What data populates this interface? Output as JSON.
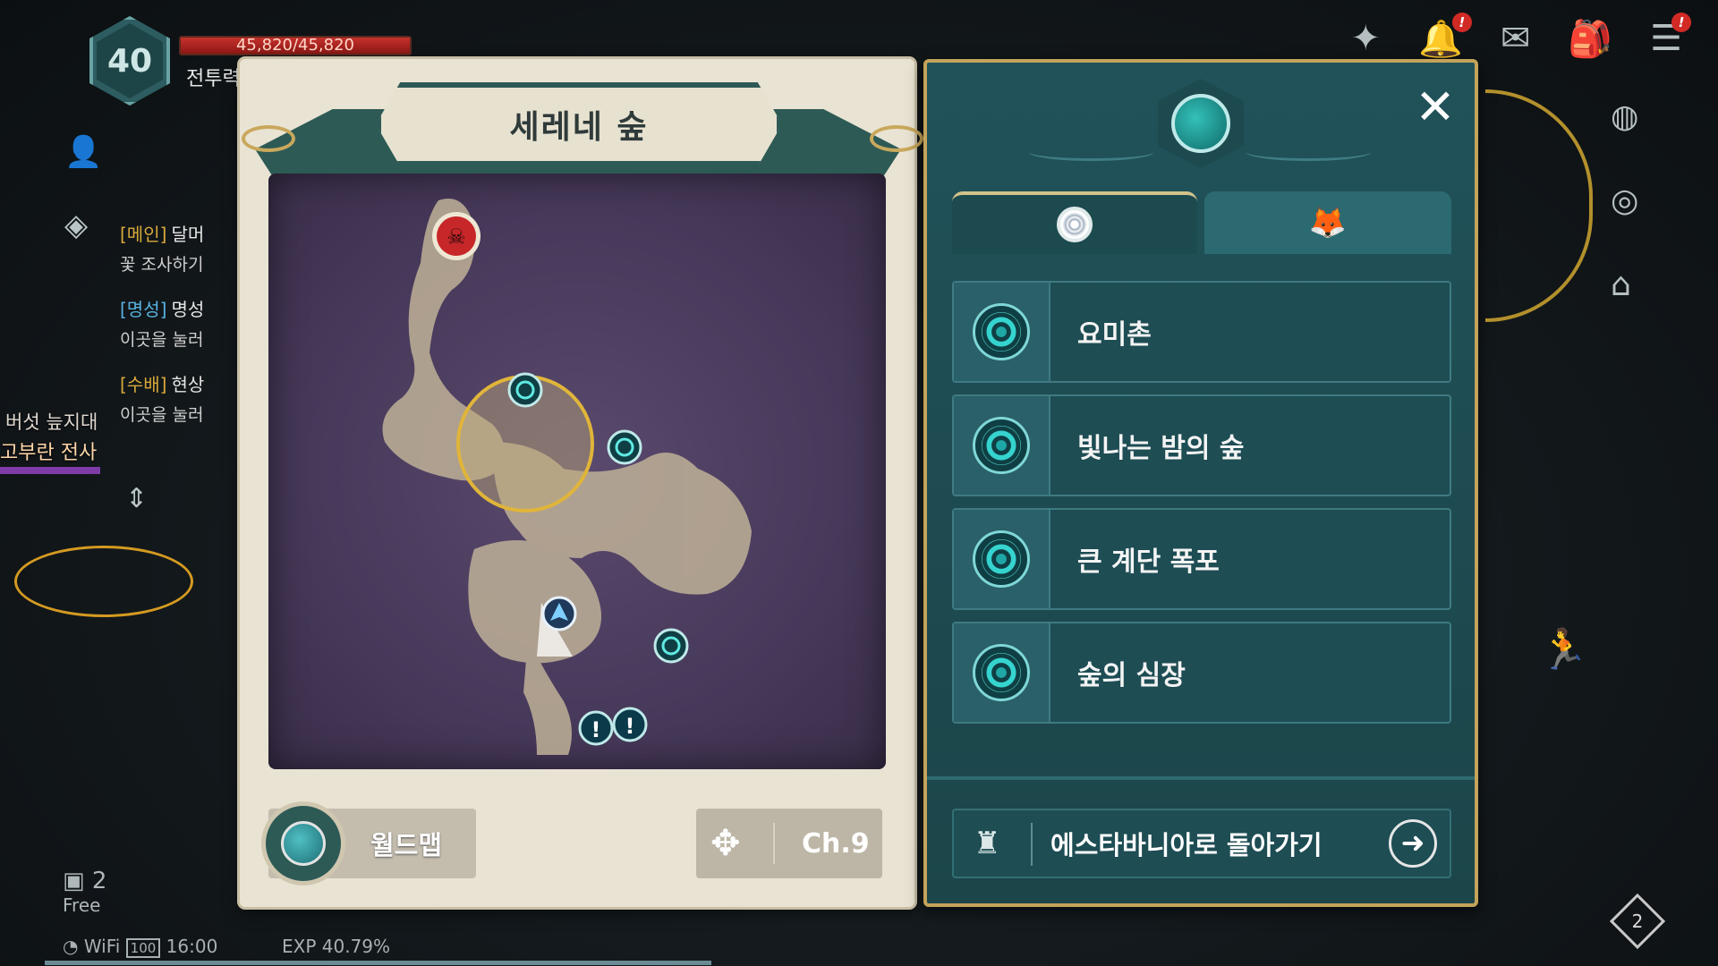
{
  "hud": {
    "level": "40",
    "hp_text": "45,820/45,820",
    "hp_fraction": 1.0,
    "cp_label": "전투력",
    "quests": [
      {
        "tag": "[메인]",
        "name": "달머",
        "sub": "꽃 조사하기",
        "tag_color": "#d8a93b"
      },
      {
        "tag": "[명성]",
        "name": "명성",
        "sub": "이곳을 눌러",
        "tag_color": "#58b3e0"
      },
      {
        "tag": "[수배]",
        "name": "현상",
        "sub": "이곳을 눌러",
        "tag_color": "#d8a93b"
      }
    ],
    "area_name": "버섯 늪지대",
    "enemy_name": "고부란 전사",
    "free_label": "Free",
    "free_count": "2",
    "wifi_label": "WiFi",
    "battery": "100",
    "clock": "16:00",
    "exp": "EXP 40.79%",
    "page_badge": "2"
  },
  "map": {
    "title": "세레네 숲",
    "world_map_label": "월드맵",
    "channel_label": "Ch.9",
    "markers": [
      {
        "type": "boss",
        "icon": "demon-skull-icon"
      },
      {
        "type": "waypoint",
        "icon": "spiral-icon"
      },
      {
        "type": "waypoint",
        "icon": "spiral-icon"
      },
      {
        "type": "waypoint",
        "icon": "spiral-icon"
      },
      {
        "type": "player",
        "icon": "player-arrow-icon"
      },
      {
        "type": "quest",
        "icon": "exclamation-icon"
      },
      {
        "type": "quest",
        "icon": "exclamation-icon"
      }
    ]
  },
  "teleport": {
    "close_symbol": "✕",
    "tabs": [
      {
        "icon": "spiral-icon",
        "active": true
      },
      {
        "icon": "fox-icon",
        "active": false
      }
    ],
    "items": [
      {
        "label": "요미촌"
      },
      {
        "label": "빛나는 밤의 숲"
      },
      {
        "label": "큰 계단 폭포"
      },
      {
        "label": "숲의 심장"
      }
    ],
    "return_label": "에스타바니아로 돌아가기"
  },
  "colors": {
    "panel_teal": "#1b4549",
    "panel_gold": "#c4a35a",
    "parchment": "#e9e3d3",
    "map_purple": "#47395a",
    "hp_red": "#c5312c"
  }
}
